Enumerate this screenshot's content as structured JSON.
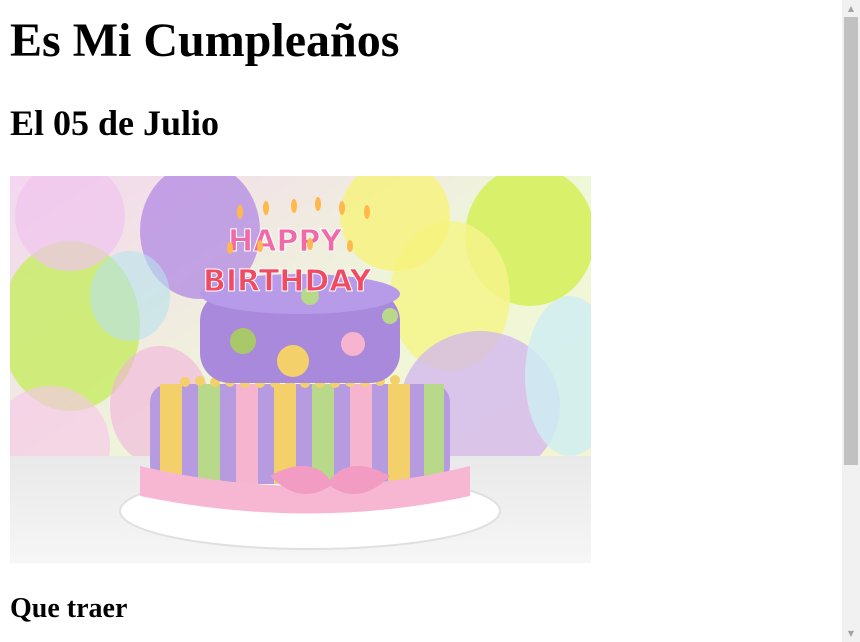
{
  "page": {
    "title": "Es Mi Cumpleaños",
    "date_heading": "El 05 de Julio",
    "section_heading": "Que traer"
  },
  "image": {
    "cake_candles_top": "HAPPY",
    "cake_candles_bottom": "BIRTHDAY"
  },
  "scrollbar": {
    "up_icon": "▲",
    "down_icon": "▼"
  }
}
